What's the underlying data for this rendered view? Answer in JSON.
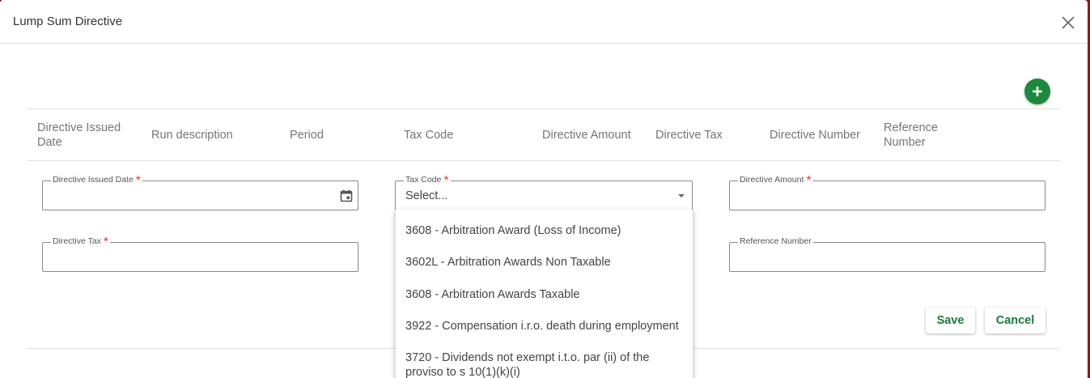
{
  "dialog": {
    "title": "Lump Sum Directive"
  },
  "table": {
    "headers": [
      "Directive Issued Date",
      "Run description",
      "Period",
      "Tax Code",
      "Directive Amount",
      "Directive Tax",
      "Directive Number",
      "Reference Number"
    ]
  },
  "form": {
    "issued_date": {
      "label": "Directive Issued Date",
      "required": true,
      "value": ""
    },
    "tax_code": {
      "label": "Tax Code",
      "required": true,
      "value": "Select..."
    },
    "amount": {
      "label": "Directive Amount",
      "required": true,
      "value": ""
    },
    "tax": {
      "label": "Directive Tax",
      "required": true,
      "value": ""
    },
    "reference": {
      "label": "Reference Number",
      "required": false,
      "value": ""
    }
  },
  "dropdown": {
    "options": [
      "3608 - Arbitration Award (Loss of Income)",
      "3602L - Arbitration Awards Non Taxable",
      "3608 - Arbitration Awards Taxable",
      "3922 - Compensation i.r.o. death during employment",
      "3720 - Dividends not exempt i.t.o. par (ii) of the proviso to s 10(1)(k)(i)"
    ]
  },
  "buttons": {
    "save": "Save",
    "cancel": "Cancel"
  },
  "colors": {
    "accent": "#1b8a3c",
    "required": "#e53935",
    "backdrop": "#8a1a1a"
  },
  "icons": {
    "close": "close-icon",
    "add": "plus-icon",
    "calendar": "calendar-icon",
    "caret": "caret-down-icon"
  }
}
